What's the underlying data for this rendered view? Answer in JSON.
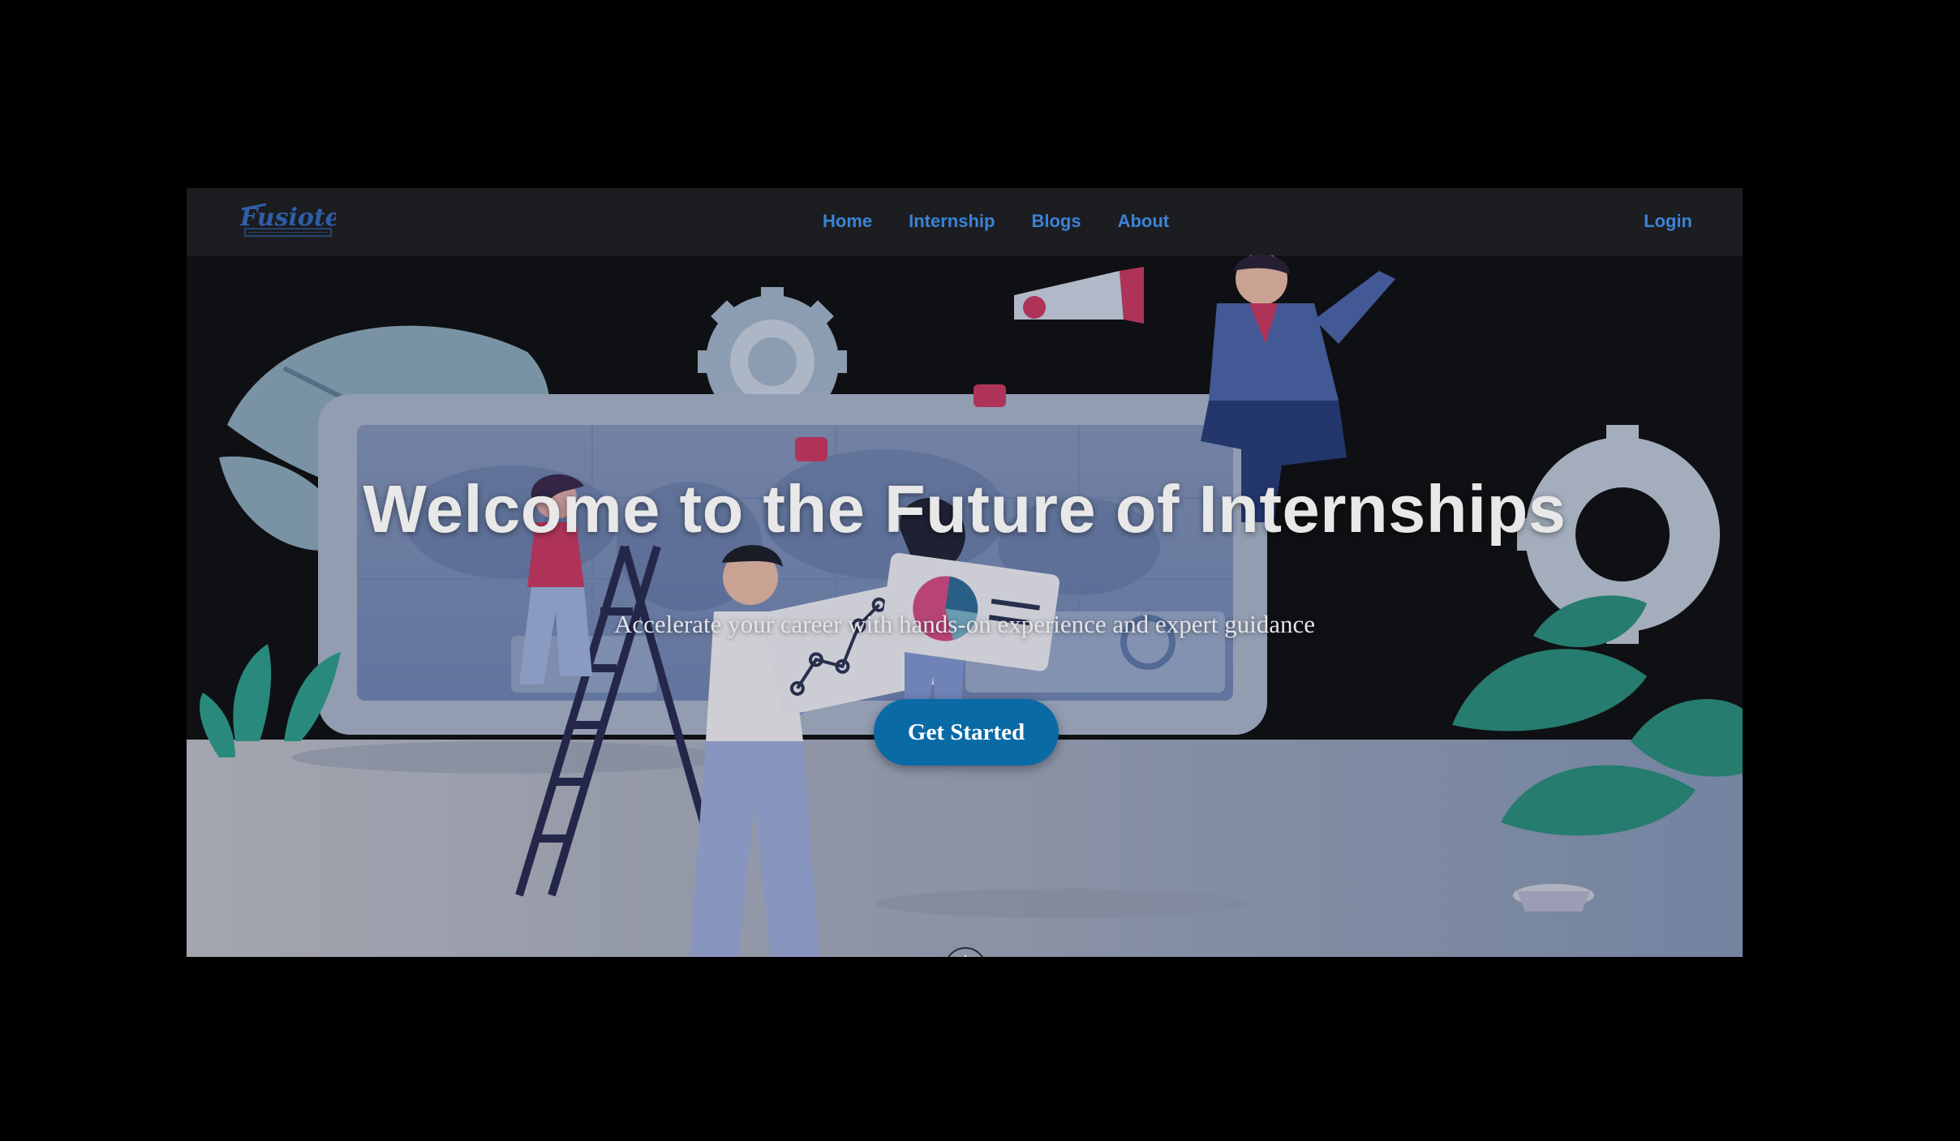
{
  "brand": {
    "name": "Fusiotech",
    "tagline": "WE TEACH. WE EMPOWER. WE TRANSFORM."
  },
  "nav": {
    "links": [
      "Home",
      "Internship",
      "Blogs",
      "About"
    ],
    "login": "Login"
  },
  "hero": {
    "title": "Welcome to the Future of Internships",
    "subtitle": "Accelerate your career with hands-on experience and expert guidance",
    "cta": "Get Started",
    "scroll_icon": "↓"
  },
  "colors": {
    "accent": "#3b83d6",
    "cta_bg": "#0a6aa6",
    "navbar_bg": "#1b1d20",
    "page_bg": "#000000"
  },
  "icons": [
    "arrow-down-icon"
  ]
}
